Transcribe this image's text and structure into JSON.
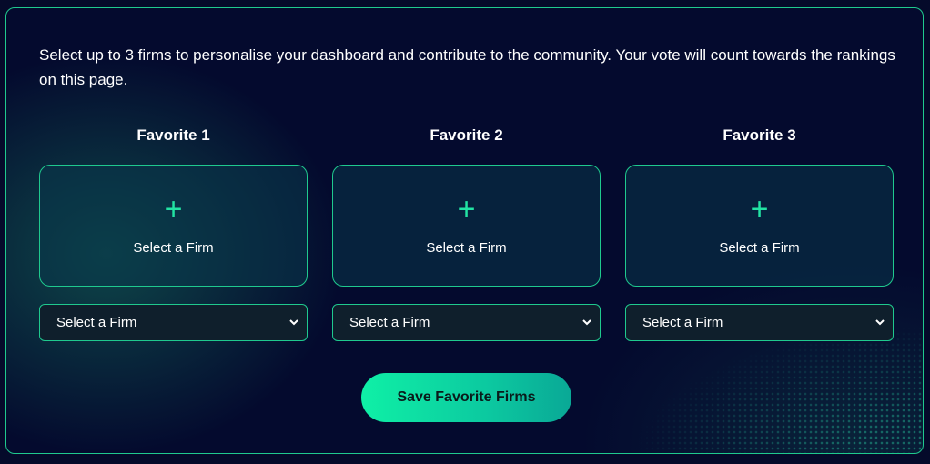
{
  "intro_text": "Select up to 3 firms to personalise your dashboard and contribute to the community. Your vote will count towards the rankings on this page.",
  "favorites": [
    {
      "title": "Favorite 1",
      "plus_symbol": "+",
      "card_label": "Select a Firm",
      "select_value": "Select a Firm"
    },
    {
      "title": "Favorite 2",
      "plus_symbol": "+",
      "card_label": "Select a Firm",
      "select_value": "Select a Firm"
    },
    {
      "title": "Favorite 3",
      "plus_symbol": "+",
      "card_label": "Select a Firm",
      "select_value": "Select a Firm"
    }
  ],
  "icons": {
    "add": "plus-icon",
    "dropdown": "chevron-down-icon"
  },
  "save_button_label": "Save Favorite Firms",
  "colors": {
    "background": "#040a2e",
    "accent": "#1fc98e",
    "plus": "#22e3a3",
    "button_gradient_start": "#0ff0a6",
    "button_gradient_end": "#0aa896"
  }
}
